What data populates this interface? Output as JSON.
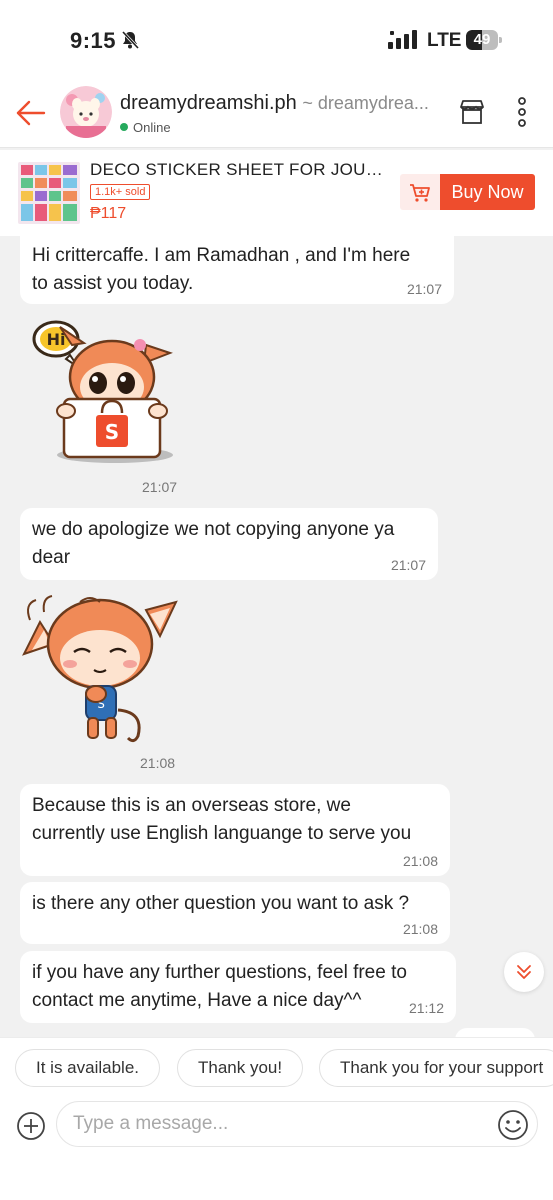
{
  "status_bar": {
    "time": "9:15",
    "network": "LTE",
    "battery": "49",
    "battery_level": 0.49
  },
  "header": {
    "shop_name": "dreamydreamshi.ph",
    "shop_handle": "~ dreamydrea...",
    "status": "Online"
  },
  "product": {
    "title": "DECO STICKER SHEET FOR JOUR...",
    "sold": "1.1k+ sold",
    "price": "₱117",
    "buy_label": "Buy Now"
  },
  "messages": [
    {
      "type": "text",
      "lines": [
        "Hi crittercaffe. I am Ramadhan , and I'm here",
        "to assist you today."
      ],
      "time": "21:07"
    },
    {
      "type": "sticker",
      "sticker": "hi-bag-sticker",
      "sticker_text": "Hi",
      "time": "21:07"
    },
    {
      "type": "text",
      "lines": [
        "we do apologize we not copying anyone ya",
        "dear"
      ],
      "time": "21:07"
    },
    {
      "type": "sticker",
      "sticker": "shy-monkey-sticker",
      "time": "21:08"
    },
    {
      "type": "text",
      "lines": [
        "Because this is an overseas store, we",
        "currently use English languange to serve you"
      ],
      "time": "21:08"
    },
    {
      "type": "text",
      "lines": [
        "is there any other question you want to ask ?"
      ],
      "time": "21:08"
    },
    {
      "type": "text",
      "lines": [
        "if you have any further questions, feel free to",
        "contact me anytime, Have a nice day^^"
      ],
      "time": "21:12"
    }
  ],
  "quick_replies": [
    "It is available.",
    "Thank you!",
    "Thank you for your support"
  ],
  "composer": {
    "placeholder": "Type a message..."
  },
  "colors": {
    "brand": "#ee4d2d",
    "online": "#26aa5d",
    "background": "#f1f1f1"
  }
}
